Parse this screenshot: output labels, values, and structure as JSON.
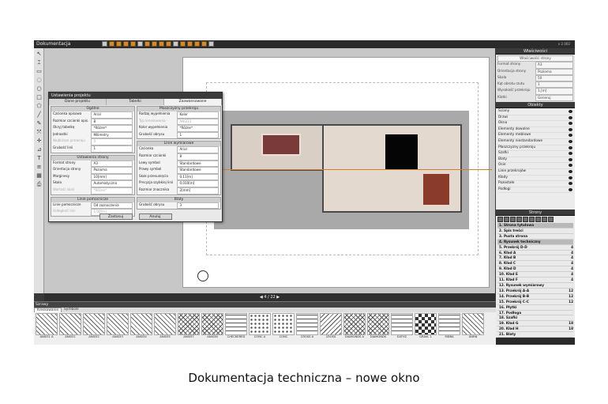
{
  "app": {
    "title": "Dokumentacja",
    "user": "v 2.002"
  },
  "left_tools": [
    "↖",
    "⌶",
    "▭",
    "◌",
    "○",
    "□",
    "⬠",
    "╱",
    "✎",
    "⤧",
    "✛",
    "⊿",
    "T",
    "≡",
    "▦",
    "⎙"
  ],
  "right_panel": {
    "props_title": "Właściwości",
    "props_subtitle": "Właściwości strony",
    "props": [
      {
        "k": "Format strony",
        "v": "A3"
      },
      {
        "k": "Orientacja strony",
        "v": "Pozioma"
      },
      {
        "k": "Skala",
        "v": "50"
      },
      {
        "k": "Kąt obrotu rzutu",
        "v": "1"
      },
      {
        "k": "Wysokość przekroju",
        "v": "1,[m]"
      },
      {
        "k": "Klatki",
        "v": "Generuj"
      }
    ],
    "objects_title": "Obiekty",
    "objects": [
      "Ściany",
      "Drzwi",
      "Okna",
      "Elementy dowolne",
      "Elementy meblowe",
      "Elementy niestandardowe",
      "Płaszczyzny przekroju",
      "Szafki",
      "Blaty",
      "Osie",
      "Linie przekrojów",
      "Kłady",
      "Pozostałe",
      "Podłogi"
    ],
    "pages_title": "Strony",
    "pages": [
      {
        "label": "1. Strona tytułowa",
        "sel": true,
        "n": ""
      },
      {
        "label": "2. Spis treści",
        "sel": false,
        "n": ""
      },
      {
        "label": "3. Pusta strona",
        "sel": false,
        "n": ""
      },
      {
        "label": "4. Rysunek techniczny",
        "sel": true,
        "n": ""
      },
      {
        "label": "5. Przekrój D-D",
        "sel": false,
        "n": "4"
      },
      {
        "label": "6. Kład A",
        "sel": false,
        "n": "4"
      },
      {
        "label": "7. Kład B",
        "sel": false,
        "n": "4"
      },
      {
        "label": "8. Kład C",
        "sel": false,
        "n": "4"
      },
      {
        "label": "9. Kład D",
        "sel": false,
        "n": "4"
      },
      {
        "label": "10. Kład E",
        "sel": false,
        "n": "4"
      },
      {
        "label": "11. Kład F",
        "sel": false,
        "n": "4"
      },
      {
        "label": "12. Rysunek wymiarowy",
        "sel": false,
        "n": ""
      },
      {
        "label": "13. Przekrój A-A",
        "sel": false,
        "n": "12"
      },
      {
        "label": "14. Przekrój B-B",
        "sel": false,
        "n": "12"
      },
      {
        "label": "15. Przekrój C-C",
        "sel": false,
        "n": "12"
      },
      {
        "label": "16. Płytki",
        "sel": false,
        "n": ""
      },
      {
        "label": "17. Podłoga",
        "sel": false,
        "n": ""
      },
      {
        "label": "18. Szafki",
        "sel": false,
        "n": ""
      },
      {
        "label": "19. Kład G",
        "sel": false,
        "n": "18"
      },
      {
        "label": "20. Kład H",
        "sel": false,
        "n": "18"
      },
      {
        "label": "21. Blaty",
        "sel": false,
        "n": ""
      }
    ]
  },
  "pagebar": {
    "text": "4 / 22"
  },
  "bottom": {
    "title": "Szrawy",
    "tabs": [
      "Kreskowanie",
      "Symbole"
    ],
    "hatches": [
      {
        "label": "ANSI31 A",
        "pattern": "diag"
      },
      {
        "label": "ANSI31",
        "pattern": "diag"
      },
      {
        "label": "ANSI32",
        "pattern": "diag"
      },
      {
        "label": "ANSI33",
        "pattern": "diag"
      },
      {
        "label": "ANSI34",
        "pattern": "diag"
      },
      {
        "label": "ANSI35",
        "pattern": "diag"
      },
      {
        "label": "ANSI37",
        "pattern": "cross"
      },
      {
        "label": "ANSI38",
        "pattern": "cross"
      },
      {
        "label": "CHECKERED",
        "pattern": "grid"
      },
      {
        "label": "CONC A",
        "pattern": "dots"
      },
      {
        "label": "CONC",
        "pattern": "dots"
      },
      {
        "label": "CROSS A",
        "pattern": "grid"
      },
      {
        "label": "CROSS",
        "pattern": "diag2"
      },
      {
        "label": "DIAMONDS A",
        "pattern": "cross"
      },
      {
        "label": "DIAMONDS",
        "pattern": "cross"
      },
      {
        "label": "EATH2",
        "pattern": "grid"
      },
      {
        "label": "GRAVL 1",
        "pattern": "check"
      },
      {
        "label": "MDBA",
        "pattern": "grid"
      },
      {
        "label": "UNRN",
        "pattern": "diag"
      }
    ]
  },
  "dialog": {
    "title": "Ustawienia projektu",
    "tabs": [
      "Dane projektu",
      "Tabelki",
      "Zaawansowane"
    ],
    "left_sections": [
      {
        "head": "Ogólne",
        "rows": [
          {
            "k": "Czcionka opisowa",
            "v": "Arial",
            "dis": false
          },
          {
            "k": "Rozmiar czcionki opis.",
            "v": "8",
            "dis": false
          },
          {
            "k": "Okryj tabelkę",
            "v": "*Różne*",
            "dis": false
          },
          {
            "k": "Jednostki",
            "v": "Milimetry",
            "dis": false
          },
          {
            "k": "Najbliższe przekroju",
            "v": "0",
            "dis": true
          },
          {
            "k": "Grubość linii",
            "v": "1",
            "dis": false
          }
        ]
      },
      {
        "head": "Ustawienia strony",
        "rows": [
          {
            "k": "Format strony",
            "v": "A3",
            "dis": false
          },
          {
            "k": "Orientacja strony",
            "v": "Pozioma",
            "dis": false
          },
          {
            "k": "Marginesy",
            "v": "10[mm]",
            "dis": false
          },
          {
            "k": "Skala",
            "v": "Automatyczna",
            "dis": false
          },
          {
            "k": "Wartość skali",
            "v": "*Różne*",
            "dis": true
          }
        ]
      },
      {
        "head": "Linie pomocnicze",
        "rows": [
          {
            "k": "Linie pomocnicze",
            "v": "Od zaznaczenia",
            "dis": false
          },
          {
            "k": "Odległość linii",
            "v": "1,00[m]",
            "dis": true
          }
        ]
      }
    ],
    "right_sections": [
      {
        "head": "Płaszczyzny przekroju",
        "rows": [
          {
            "k": "Rodzaj wypełnienia",
            "v": "Kolor",
            "dis": false
          },
          {
            "k": "Typ kreskowania",
            "v": "ANSI31",
            "dis": true
          },
          {
            "k": "Kolor wypełnienia",
            "v": "*Różne*",
            "dis": false
          },
          {
            "k": "Grubość obrysu",
            "v": "1",
            "dis": false
          }
        ]
      },
      {
        "head": "Linie wymiarowe",
        "rows": [
          {
            "k": "Czcionka",
            "v": "Arial",
            "dis": false
          },
          {
            "k": "Rozmiar czcionki",
            "v": "8",
            "dis": false
          },
          {
            "k": "Lewy symbol",
            "v": "Standardowe",
            "dis": false
          },
          {
            "k": "Prawy symbol",
            "v": "Standardowe",
            "dis": false
          },
          {
            "k": "Skok przesunięcia",
            "v": "0,11[m]",
            "dis": false
          },
          {
            "k": "Precyzja szybkiej linii",
            "v": "0,010[m]",
            "dis": false
          },
          {
            "k": "Rozmiar znacznika",
            "v": "2[mm]",
            "dis": false
          }
        ]
      },
      {
        "head": "Blaty",
        "rows": [
          {
            "k": "Grubość obrysu",
            "v": "3",
            "dis": false
          }
        ]
      }
    ],
    "ok": "Zastosuj",
    "cancel": "Anuluj"
  },
  "caption": "Dokumentacja techniczna – nowe okno"
}
